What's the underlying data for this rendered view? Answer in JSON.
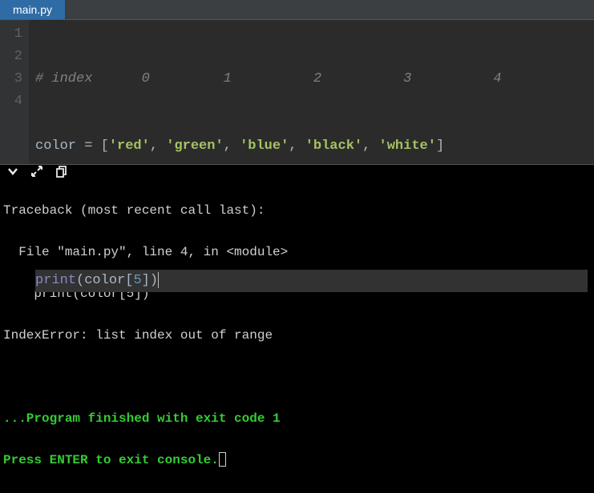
{
  "tab": {
    "name": "main.py"
  },
  "editor": {
    "gutter": [
      "1",
      "2",
      "3",
      "4"
    ],
    "line1": {
      "hash": "# ",
      "word": "index",
      "i0": "0",
      "i1": "1",
      "i2": "2",
      "i3": "3",
      "i4": "4"
    },
    "line2": {
      "var": "color",
      "eq": " = ",
      "lb": "[",
      "s0": "'red'",
      "c": ", ",
      "s1": "'green'",
      "s2": "'blue'",
      "s3": "'black'",
      "s4": "'white'",
      "rb": "]"
    },
    "line4": {
      "fn": "print",
      "lp": "(",
      "var": "color",
      "lbr": "[",
      "idx": "5",
      "rbr": "]",
      "rp": ")"
    }
  },
  "console": {
    "l1": "Traceback (most recent call last):",
    "l2": "  File \"main.py\", line 4, in <module>",
    "l3": "    print(color[5])",
    "l4": "IndexError: list index out of range",
    "l5": "",
    "l6": "",
    "l7": "...Program finished with exit code 1",
    "l8": "Press ENTER to exit console."
  }
}
